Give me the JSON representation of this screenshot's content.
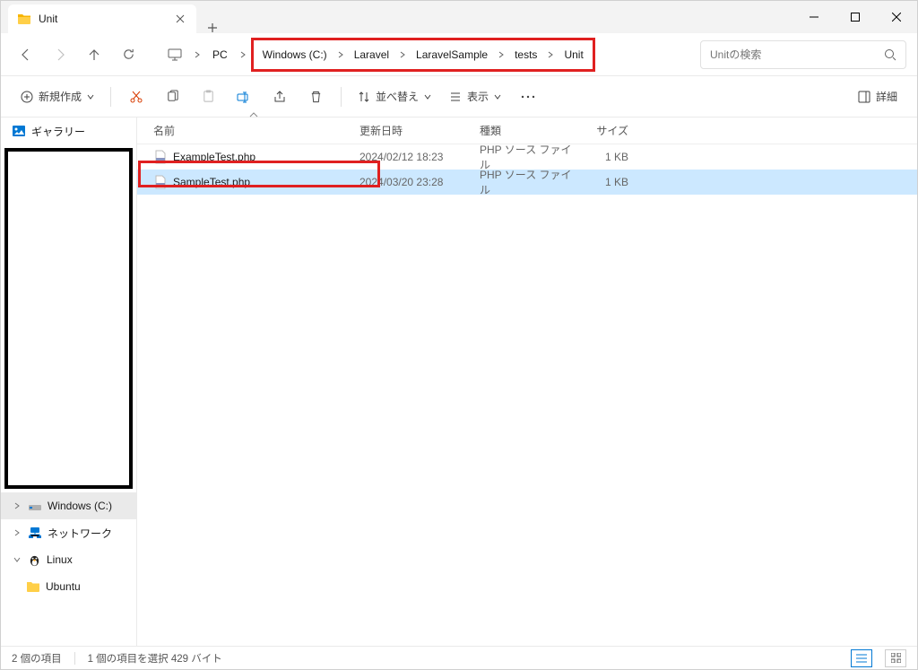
{
  "tab": {
    "title": "Unit"
  },
  "breadcrumb": {
    "pc": "PC",
    "items": [
      "Windows (C:)",
      "Laravel",
      "LaravelSample",
      "tests",
      "Unit"
    ]
  },
  "search": {
    "placeholder": "Unitの検索"
  },
  "toolbar": {
    "new": "新規作成",
    "sort": "並べ替え",
    "view": "表示",
    "details": "詳細"
  },
  "columns": {
    "name": "名前",
    "date": "更新日時",
    "type": "種類",
    "size": "サイズ"
  },
  "sidebar": {
    "gallery": "ギャラリー",
    "windows_c": "Windows (C:)",
    "network": "ネットワーク",
    "linux": "Linux",
    "ubuntu": "Ubuntu"
  },
  "files": [
    {
      "name": "ExampleTest.php",
      "date": "2024/02/12 18:23",
      "type": "PHP ソース ファイル",
      "size": "1 KB"
    },
    {
      "name": "SampleTest.php",
      "date": "2024/03/20 23:28",
      "type": "PHP ソース ファイル",
      "size": "1 KB"
    }
  ],
  "status": {
    "count": "2 個の項目",
    "selection": "1 個の項目を選択 429 バイト"
  }
}
